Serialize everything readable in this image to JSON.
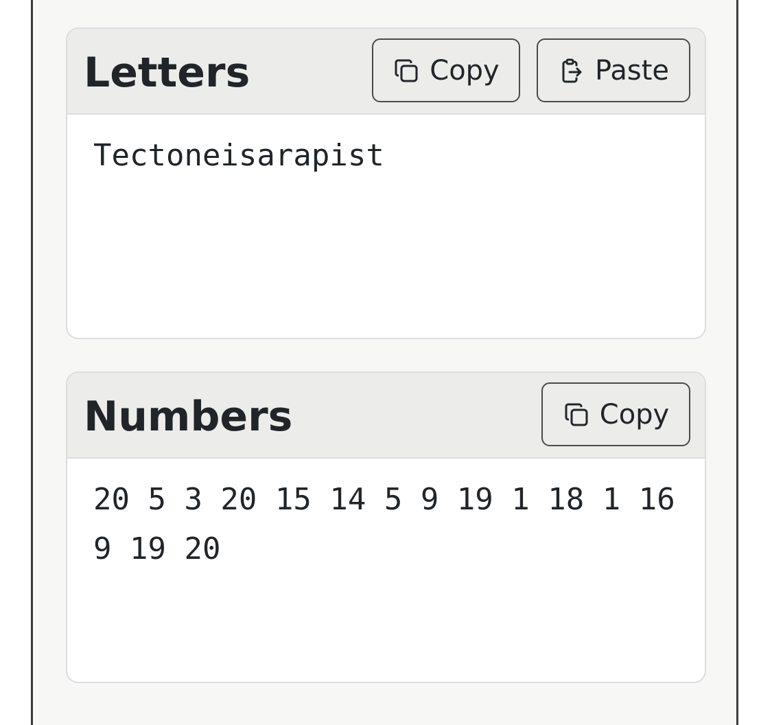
{
  "letters": {
    "title": "Letters",
    "copy_label": "Copy",
    "copy_icon": "copy-icon",
    "paste_label": "Paste",
    "paste_icon": "paste-icon",
    "value": "Tectoneisarapist"
  },
  "numbers": {
    "title": "Numbers",
    "copy_label": "Copy",
    "copy_icon": "copy-icon",
    "value": "20 5 3 20 15 14 5 9 19 1 18 1 16 9 19 20"
  }
}
